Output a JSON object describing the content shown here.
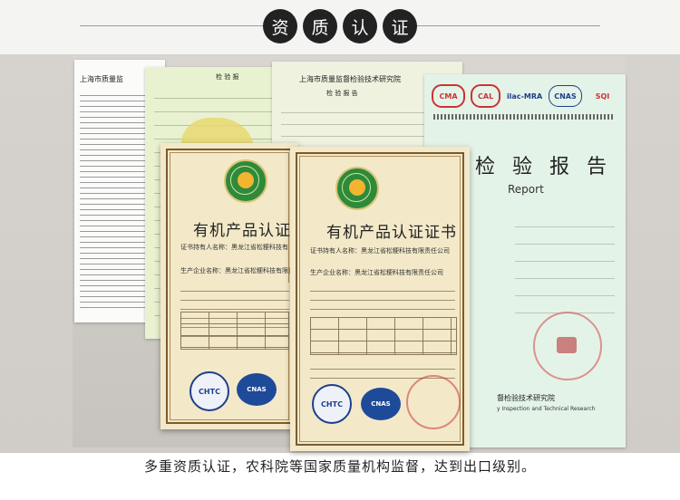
{
  "header": {
    "title_chars": [
      "资",
      "质",
      "认",
      "证"
    ]
  },
  "doc_left": {
    "title": "上海市质量监"
  },
  "doc_green": {
    "title": "检 验 报"
  },
  "doc_top": {
    "title": "上海市质量监督检验技术研究院",
    "subtitle": "检 验 报 告"
  },
  "doc_report": {
    "logos": [
      "CMA",
      "CAL",
      "ilac-MRA",
      "CNAS",
      "SQI"
    ],
    "report_title": "检 验 报 告",
    "report_en": "Report",
    "institute": "督检验技术研究院",
    "institute_en": "y Inspection and Technical Research"
  },
  "cert_back": {
    "title": "有机产品认证",
    "holder_label": "证书持有人名称：黑龙江省松粳科技有",
    "producer_label": "生产企业名称：黑龙江省松粳科技有限责",
    "badge_left": "CHTC",
    "badge_right": "CNAS"
  },
  "cert_front": {
    "title": "有机产品认证证书",
    "holder_label": "证书持有人名称：黑龙江省松粳科技有限责任公司",
    "producer_label": "生产企业名称：黑龙江省松粳科技有限责任公司",
    "badge_left": "CHTC",
    "badge_right": "CNAS"
  },
  "caption": "多重资质认证，农科院等国家质量机构监督，达到出口级别。"
}
